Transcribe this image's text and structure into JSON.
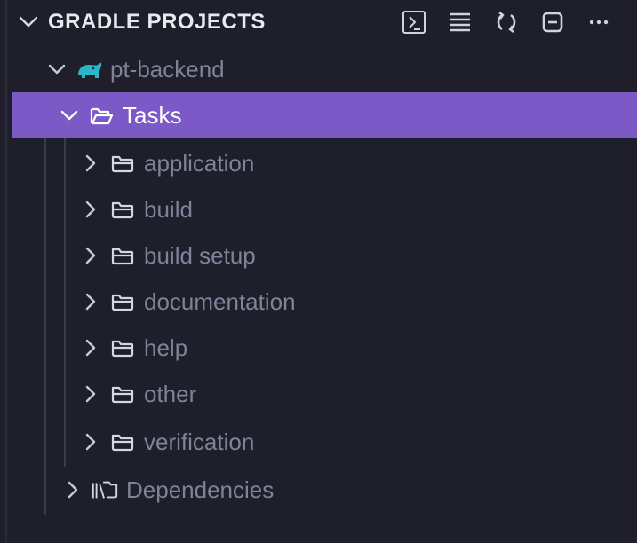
{
  "header": {
    "title": "GRADLE PROJECTS"
  },
  "toolbar": {
    "icons": [
      "terminal-icon",
      "list-icon",
      "refresh-icon",
      "collapse-all-icon",
      "more-icon"
    ]
  },
  "tree": {
    "project": {
      "label": "pt-backend",
      "icon": "gradle-elephant-icon"
    },
    "tasks": {
      "label": "Tasks",
      "selected": true
    },
    "task_groups": [
      {
        "label": "application"
      },
      {
        "label": "build"
      },
      {
        "label": "build setup"
      },
      {
        "label": "documentation"
      },
      {
        "label": "help"
      },
      {
        "label": "other"
      },
      {
        "label": "verification"
      }
    ],
    "dependencies": {
      "label": "Dependencies",
      "icon": "library-icon"
    }
  },
  "colors": {
    "background": "#1e1f2b",
    "selection": "#7b59c6",
    "gradle_icon": "#2bb5c9",
    "dim_text": "#7e8398"
  }
}
